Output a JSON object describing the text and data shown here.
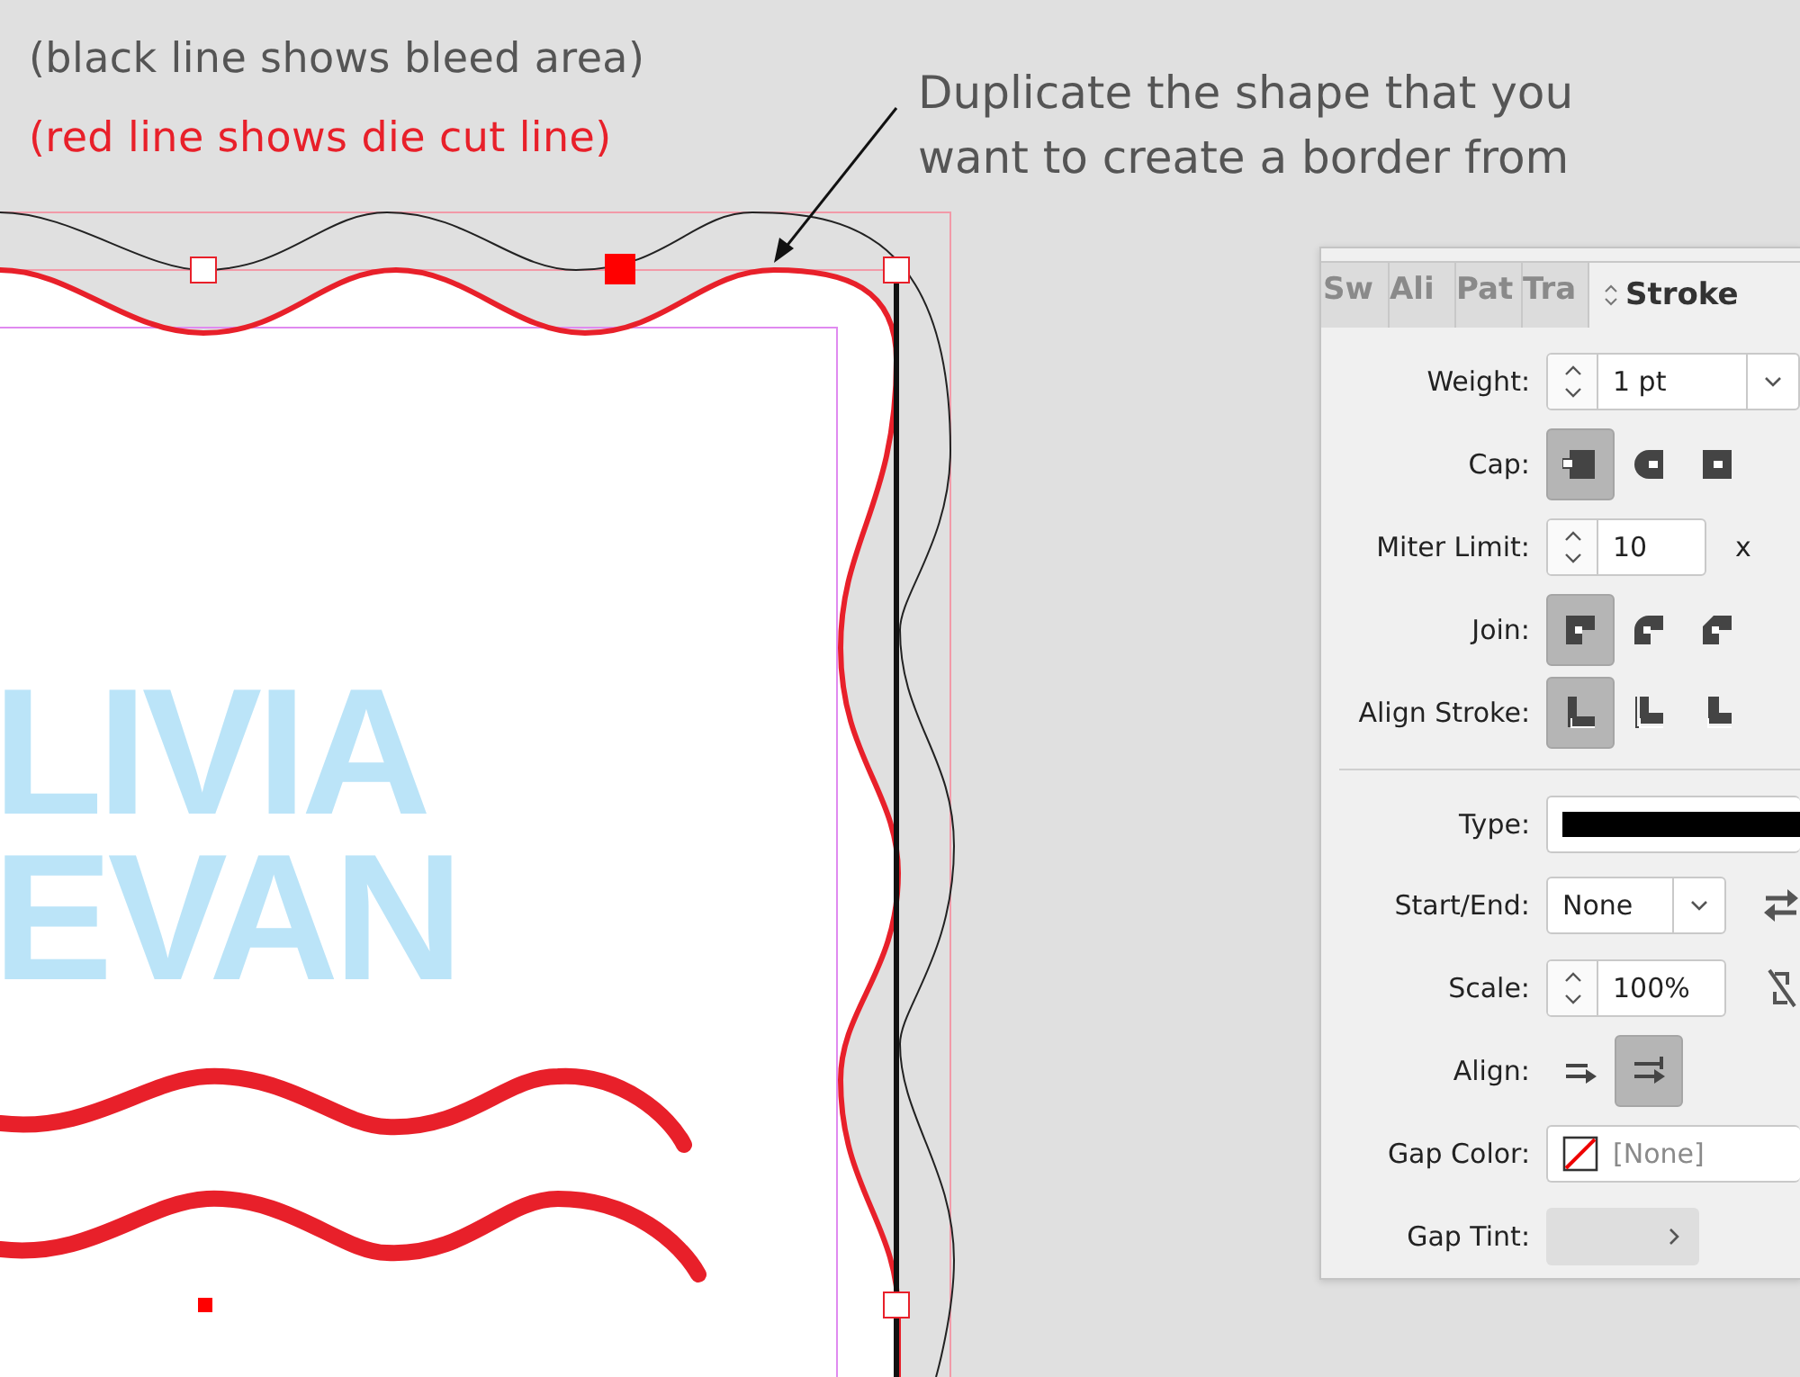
{
  "annotations": [
    {
      "text": "(black line shows bleed area)",
      "color": "#555555"
    },
    {
      "text": "(red line shows die cut line)",
      "color": "#e8202a"
    }
  ],
  "callout": {
    "lines": [
      "Duplicate the shape that you",
      "want to create a border from"
    ]
  },
  "document": {
    "heading_lines": [
      "LIVIA",
      "EVAN"
    ]
  },
  "panel": {
    "tabs": [
      {
        "label": "Sw",
        "selected": false
      },
      {
        "label": "Ali",
        "selected": false
      },
      {
        "label": "Pat",
        "selected": false
      },
      {
        "label": "Tra",
        "selected": false
      },
      {
        "label": "Stroke",
        "selected": true
      }
    ],
    "rows": [
      {
        "kind": "weight",
        "label": "Weight:",
        "value": "1 pt"
      },
      {
        "kind": "cap",
        "label": "Cap:",
        "options": [
          {
            "selected": true
          },
          {
            "selected": false
          },
          {
            "selected": false
          }
        ]
      },
      {
        "kind": "miter",
        "label": "Miter Limit:",
        "value": "10",
        "suffix": "x"
      },
      {
        "kind": "join",
        "label": "Join:",
        "options": [
          {
            "selected": true
          },
          {
            "selected": false
          },
          {
            "selected": false
          }
        ]
      },
      {
        "kind": "align-stroke",
        "label": "Align Stroke:",
        "options": [
          {
            "selected": true
          },
          {
            "selected": false
          },
          {
            "selected": false
          }
        ]
      },
      {
        "kind": "divider"
      },
      {
        "kind": "type",
        "label": "Type:"
      },
      {
        "kind": "start-end",
        "label": "Start/End:",
        "value": "None"
      },
      {
        "kind": "scale",
        "label": "Scale:",
        "value": "100%"
      },
      {
        "kind": "align",
        "label": "Align:",
        "options": [
          {
            "selected": false
          },
          {
            "selected": true
          }
        ]
      },
      {
        "kind": "gap-color",
        "label": "Gap Color:",
        "value": "[None]"
      },
      {
        "kind": "gap-tint",
        "label": "Gap Tint:"
      }
    ]
  }
}
